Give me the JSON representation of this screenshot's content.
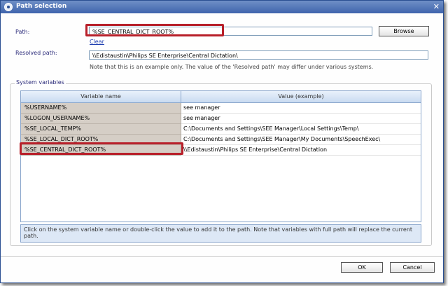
{
  "window": {
    "title": "Path selection"
  },
  "path": {
    "label": "Path:",
    "value": "%SE_CENTRAL_DICT_ROOT%",
    "browse_label": "Browse",
    "clear_label": "Clear"
  },
  "resolved": {
    "label": "Resolved path:",
    "value": "\\\\Edistaustin\\Philips SE Enterprise\\Central Dictation\\",
    "note": "Note that this is an example only. The value of the 'Resolved path' may differ under various systems."
  },
  "system_variables": {
    "legend": "System variables",
    "columns": [
      "Variable name",
      "Value (example)"
    ],
    "rows": [
      {
        "name": "%USERNAME%",
        "value": "see manager"
      },
      {
        "name": "%LOGON_USERNAME%",
        "value": "see manager"
      },
      {
        "name": "%SE_LOCAL_TEMP%",
        "value": "C:\\Documents and Settings\\SEE Manager\\Local Settings\\Temp\\"
      },
      {
        "name": "%SE_LOCAL_DICT_ROOT%",
        "value": "C:\\Documents and Settings\\SEE Manager\\My Documents\\SpeechExec\\"
      },
      {
        "name": "%SE_CENTRAL_DICT_ROOT%",
        "value": "\\\\Edistaustin\\Philips SE Enterprise\\Central Dictation"
      }
    ],
    "hint": "Click on the system variable name or double-click the value to add it to the path. Note that variables with full path will replace the current path."
  },
  "buttons": {
    "ok": "OK",
    "cancel": "Cancel"
  },
  "colors": {
    "highlight": "#b8202a",
    "titlebar": "#3f64ad"
  }
}
